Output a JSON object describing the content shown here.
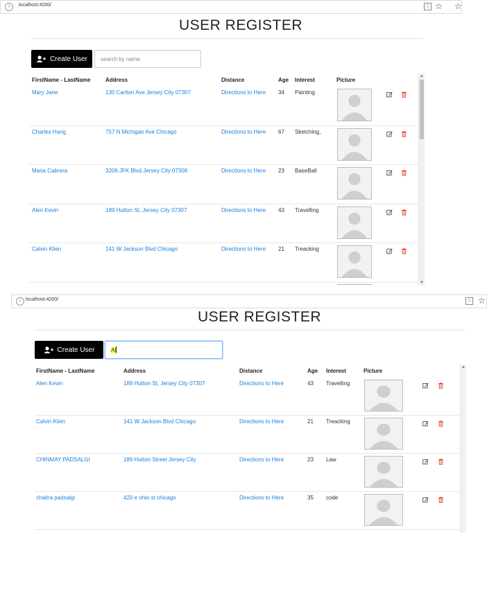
{
  "colors": {
    "link": "#1a7fd9",
    "button_bg": "#000000",
    "delete": "#e53935",
    "highlight": "#ffff33"
  },
  "shot1": {
    "url": "localhost:4200/",
    "title": "USER REGISTER",
    "create_button": "Create User",
    "search_placeholder": "search by name",
    "columns": [
      "FirstName - LastName",
      "Address",
      "Distance",
      "Age",
      "Interest",
      "Picture"
    ],
    "rows": [
      {
        "name": "Mary Jane",
        "address": "130 Carlton Ave Jersey City 07307",
        "distance": "Directions to Here",
        "age": "34",
        "interest": "Painting"
      },
      {
        "name": "Charles Harig",
        "address": "757 N Michigan Ave Chicago",
        "distance": "Directions to Here",
        "age": "67",
        "interest": "Sketching,"
      },
      {
        "name": "Maria Cabrera",
        "address": "3206 JFK Blvd Jersey City 07306",
        "distance": "Directions to Here",
        "age": "23",
        "interest": "BaseBall"
      },
      {
        "name": "Alen Kevin",
        "address": "189 Hutton St, Jersey City 07307",
        "distance": "Directions to Here",
        "age": "43",
        "interest": "Travelling"
      },
      {
        "name": "Calvin Klien",
        "address": "141 W Jackson Blvd Chicago",
        "distance": "Directions to Here",
        "age": "21",
        "interest": "Treacking"
      }
    ]
  },
  "shot2": {
    "url": "localhost:4200/",
    "title": "USER REGISTER",
    "create_button": "Create User",
    "search_value": "Al",
    "columns": [
      "FirstName - LastName",
      "Address",
      "Distance",
      "Age",
      "Interest",
      "Picture"
    ],
    "rows": [
      {
        "name": "Alen Kevin",
        "address": "189 Hutton St, Jersey City 07307",
        "distance": "Directions to Here",
        "age": "43",
        "interest": "Travelling"
      },
      {
        "name": "Calvin Klien",
        "address": "141 W Jackson Blvd Chicago",
        "distance": "Directions to Here",
        "age": "21",
        "interest": "Treacking"
      },
      {
        "name": "CHINMAY PADSALGI",
        "address": "189 Hutton Street Jersey City",
        "distance": "Directions to Here",
        "age": "23",
        "interest": "Law"
      },
      {
        "name": "chaitra padsalgi",
        "address": "420 e ohio st chicago",
        "distance": "Directions to Here",
        "age": "35",
        "interest": "code"
      }
    ]
  }
}
